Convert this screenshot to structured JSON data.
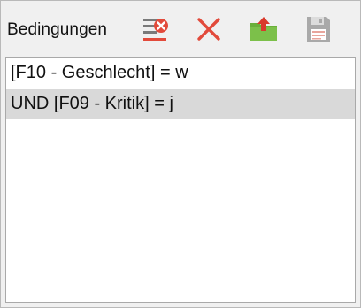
{
  "panel": {
    "title": "Bedingungen"
  },
  "toolbar": {
    "buttons": [
      {
        "name": "remove-condition",
        "icon": "list-remove-icon",
        "color": "#e24a3b"
      },
      {
        "name": "delete",
        "icon": "close-x-icon",
        "color": "#e24a3b"
      },
      {
        "name": "export",
        "icon": "folder-upload-icon",
        "color": "#6aaf3a"
      },
      {
        "name": "save",
        "icon": "floppy-save-icon",
        "color": "#a9a9a9"
      }
    ]
  },
  "conditions": [
    {
      "text": "[F10 - Geschlecht] = w",
      "selected": false
    },
    {
      "text": "UND [F09 - Kritik] = j",
      "selected": true
    }
  ]
}
